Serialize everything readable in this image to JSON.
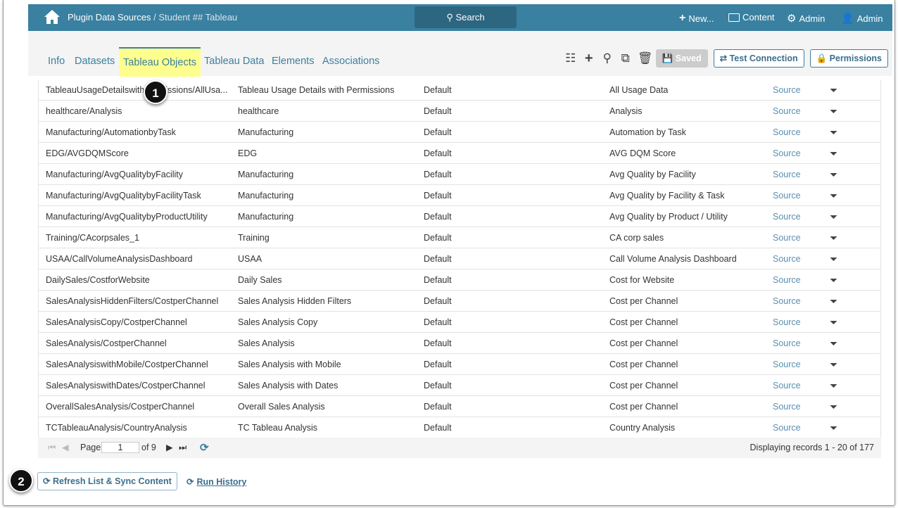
{
  "header": {
    "breadcrumb_main": "Plugin Data Sources",
    "breadcrumb_sub": " / Student ## Tableau",
    "search": "Search",
    "new": "New...",
    "content": "Content",
    "admin_settings": "Admin",
    "admin_user": "Admin"
  },
  "tabs": [
    "Info",
    "Datasets",
    "Tableau Objects",
    "Tableau Data",
    "Elements",
    "Associations"
  ],
  "toolbar": {
    "saved": "Saved",
    "test_connection": "Test Connection",
    "permissions": "Permissions"
  },
  "rows": [
    [
      "TableauUsageDetailswithPermissions/AllUsa...",
      "Tableau Usage Details with Permissions",
      "Default",
      "All Usage Data",
      "Source"
    ],
    [
      "healthcare/Analysis",
      "healthcare",
      "Default",
      "Analysis",
      "Source"
    ],
    [
      "Manufacturing/AutomationbyTask",
      "Manufacturing",
      "Default",
      "Automation by Task",
      "Source"
    ],
    [
      "EDG/AVGDQMScore",
      "EDG",
      "Default",
      "AVG DQM Score",
      "Source"
    ],
    [
      "Manufacturing/AvgQualitybyFacility",
      "Manufacturing",
      "Default",
      "Avg Quality by Facility",
      "Source"
    ],
    [
      "Manufacturing/AvgQualitybyFacilityTask",
      "Manufacturing",
      "Default",
      "Avg Quality by Facility & Task",
      "Source"
    ],
    [
      "Manufacturing/AvgQualitybyProductUtility",
      "Manufacturing",
      "Default",
      "Avg Quality by Product / Utility",
      "Source"
    ],
    [
      "Training/CAcorpsales_1",
      "Training",
      "Default",
      "CA corp sales",
      "Source"
    ],
    [
      "USAA/CallVolumeAnalysisDashboard",
      "USAA",
      "Default",
      "Call Volume Analysis Dashboard",
      "Source"
    ],
    [
      "DailySales/CostforWebsite",
      "Daily Sales",
      "Default",
      "Cost for Website",
      "Source"
    ],
    [
      "SalesAnalysisHiddenFilters/CostperChannel",
      "Sales Analysis Hidden Filters",
      "Default",
      "Cost per Channel",
      "Source"
    ],
    [
      "SalesAnalysisCopy/CostperChannel",
      "Sales Analysis Copy",
      "Default",
      "Cost per Channel",
      "Source"
    ],
    [
      "SalesAnalysis/CostperChannel",
      "Sales Analysis",
      "Default",
      "Cost per Channel",
      "Source"
    ],
    [
      "SalesAnalysiswithMobile/CostperChannel",
      "Sales Analysis with Mobile",
      "Default",
      "Cost per Channel",
      "Source"
    ],
    [
      "SalesAnalysiswithDates/CostperChannel",
      "Sales Analysis with Dates",
      "Default",
      "Cost per Channel",
      "Source"
    ],
    [
      "OverallSalesAnalysis/CostperChannel",
      "Overall Sales Analysis",
      "Default",
      "Cost per Channel",
      "Source"
    ],
    [
      "TCTableauAnalysis/CountryAnalysis",
      "TC Tableau Analysis",
      "Default",
      "Country Analysis",
      "Source"
    ]
  ],
  "pager": {
    "page_label": "Page",
    "page_value": "1",
    "of": "of 9",
    "display": "Displaying records 1 - 20 of 177"
  },
  "footer": {
    "refresh": "Refresh List & Sync Content",
    "run_history": "Run History"
  },
  "badges": [
    "1",
    "2"
  ]
}
